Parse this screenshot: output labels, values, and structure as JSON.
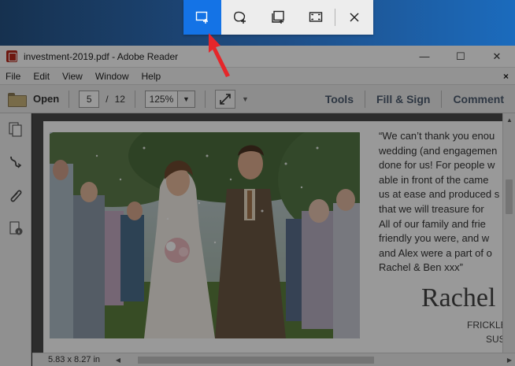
{
  "window": {
    "title": "investment-2019.pdf - Adobe Reader",
    "controls": {
      "minimize": "—",
      "maximize": "☐",
      "close": "✕"
    }
  },
  "menu": {
    "items": [
      "File",
      "Edit",
      "View",
      "Window",
      "Help"
    ],
    "close_document": "×"
  },
  "toolbar": {
    "open_label": "Open",
    "page_current": "5",
    "page_separator": "/",
    "page_total": "12",
    "zoom_value": "125%",
    "tools_label": "Tools",
    "fill_sign_label": "Fill & Sign",
    "comment_label": "Comment"
  },
  "document": {
    "quote_text": "“We can’t thank you enou\nwedding (and engagemen\ndone for us! For people w\nable in front of the came\nus at ease and produced s\nthat we will treasure for\nAll of our family and frie\nfriendly you were, and w\nand Alex were a part of o\nRachel & Ben xxx”",
    "signature": "Rachel",
    "address_line1": "FRICKLE",
    "address_line2": "SUS"
  },
  "status": {
    "page_size": "5.83 x 8.27 in"
  },
  "snip_toolbar": {
    "modes": [
      {
        "id": "rectangular",
        "icon": "rectangular-snip-icon",
        "active": true
      },
      {
        "id": "freeform",
        "icon": "freeform-snip-icon",
        "active": false
      },
      {
        "id": "window",
        "icon": "window-snip-icon",
        "active": false
      },
      {
        "id": "fullscreen",
        "icon": "fullscreen-snip-icon",
        "active": false
      }
    ],
    "close_icon": "close-icon",
    "accent_color": "#1473e6"
  },
  "annotation": {
    "arrow_color": "#e5262a"
  }
}
